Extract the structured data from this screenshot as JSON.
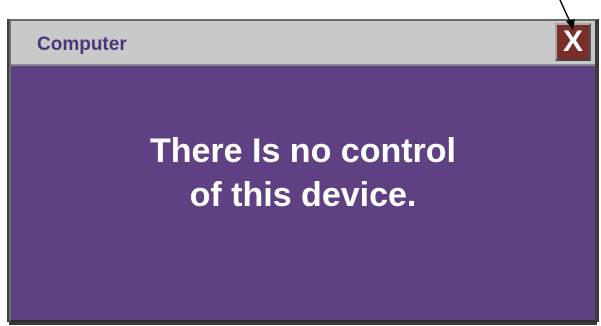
{
  "dialog": {
    "title": "Computer",
    "close_label": "X",
    "message_lines": [
      "There Is no control",
      "of this device."
    ]
  },
  "colors": {
    "dialog_background": "#5e4083",
    "titlebar_background": "#c9c9c9",
    "title_text": "#4e3578",
    "close_button": "#7a2e29",
    "message_text": "#ffffff"
  },
  "icons": {
    "annotation_arrow": "pointer-arrow-icon"
  }
}
